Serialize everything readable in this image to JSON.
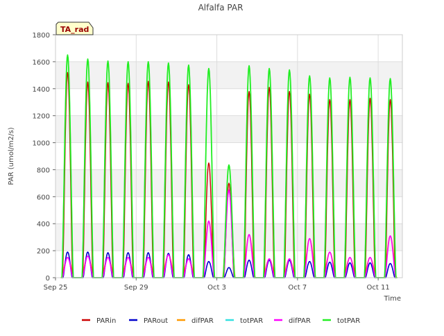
{
  "chart_data": {
    "type": "line",
    "title": "Alfalfa PAR",
    "xlabel": "Time",
    "ylabel": "PAR (umol/m2/s)",
    "badge": "TA_rad",
    "xlim": [
      0,
      17.2
    ],
    "ylim": [
      0,
      1800
    ],
    "x_ticks": [
      {
        "x": 0,
        "label": "Sep 25"
      },
      {
        "x": 4,
        "label": "Sep 29"
      },
      {
        "x": 8,
        "label": "Oct 3"
      },
      {
        "x": 12,
        "label": "Oct 7"
      },
      {
        "x": 16,
        "label": "Oct 11"
      }
    ],
    "y_ticks": [
      0,
      200,
      400,
      600,
      800,
      1000,
      1200,
      1400,
      1600,
      1800
    ],
    "grid": true,
    "legend_position": "bottom",
    "daily_peaks": {
      "day_index": [
        0,
        1,
        2,
        3,
        4,
        5,
        6,
        7,
        8,
        9,
        10,
        11,
        12,
        13,
        14,
        15,
        16
      ],
      "PARin": [
        1520,
        1450,
        1445,
        1440,
        1455,
        1450,
        1430,
        850,
        700,
        1380,
        1410,
        1380,
        1360,
        1320,
        1320,
        1330,
        1320
      ],
      "PARout": [
        190,
        190,
        185,
        185,
        185,
        180,
        170,
        120,
        75,
        130,
        130,
        130,
        120,
        115,
        110,
        110,
        105
      ],
      "difPAR": [
        150,
        160,
        150,
        150,
        150,
        170,
        140,
        420,
        650,
        320,
        140,
        140,
        290,
        190,
        150,
        150,
        310
      ],
      "totPAR": [
        1650,
        1620,
        1605,
        1600,
        1600,
        1590,
        1575,
        1550,
        835,
        1570,
        1550,
        1540,
        1495,
        1480,
        1485,
        1480,
        1475
      ]
    },
    "series": [
      {
        "name": "PARin",
        "color": "#cc0000"
      },
      {
        "name": "PARout",
        "color": "#0000cc"
      },
      {
        "name": "difPAR",
        "color": "#ff9900"
      },
      {
        "name": "totPAR",
        "color": "#33e0e0"
      },
      {
        "name": "difPAR",
        "color": "#ff00ff"
      },
      {
        "name": "totPAR",
        "color": "#22ee22"
      }
    ]
  }
}
